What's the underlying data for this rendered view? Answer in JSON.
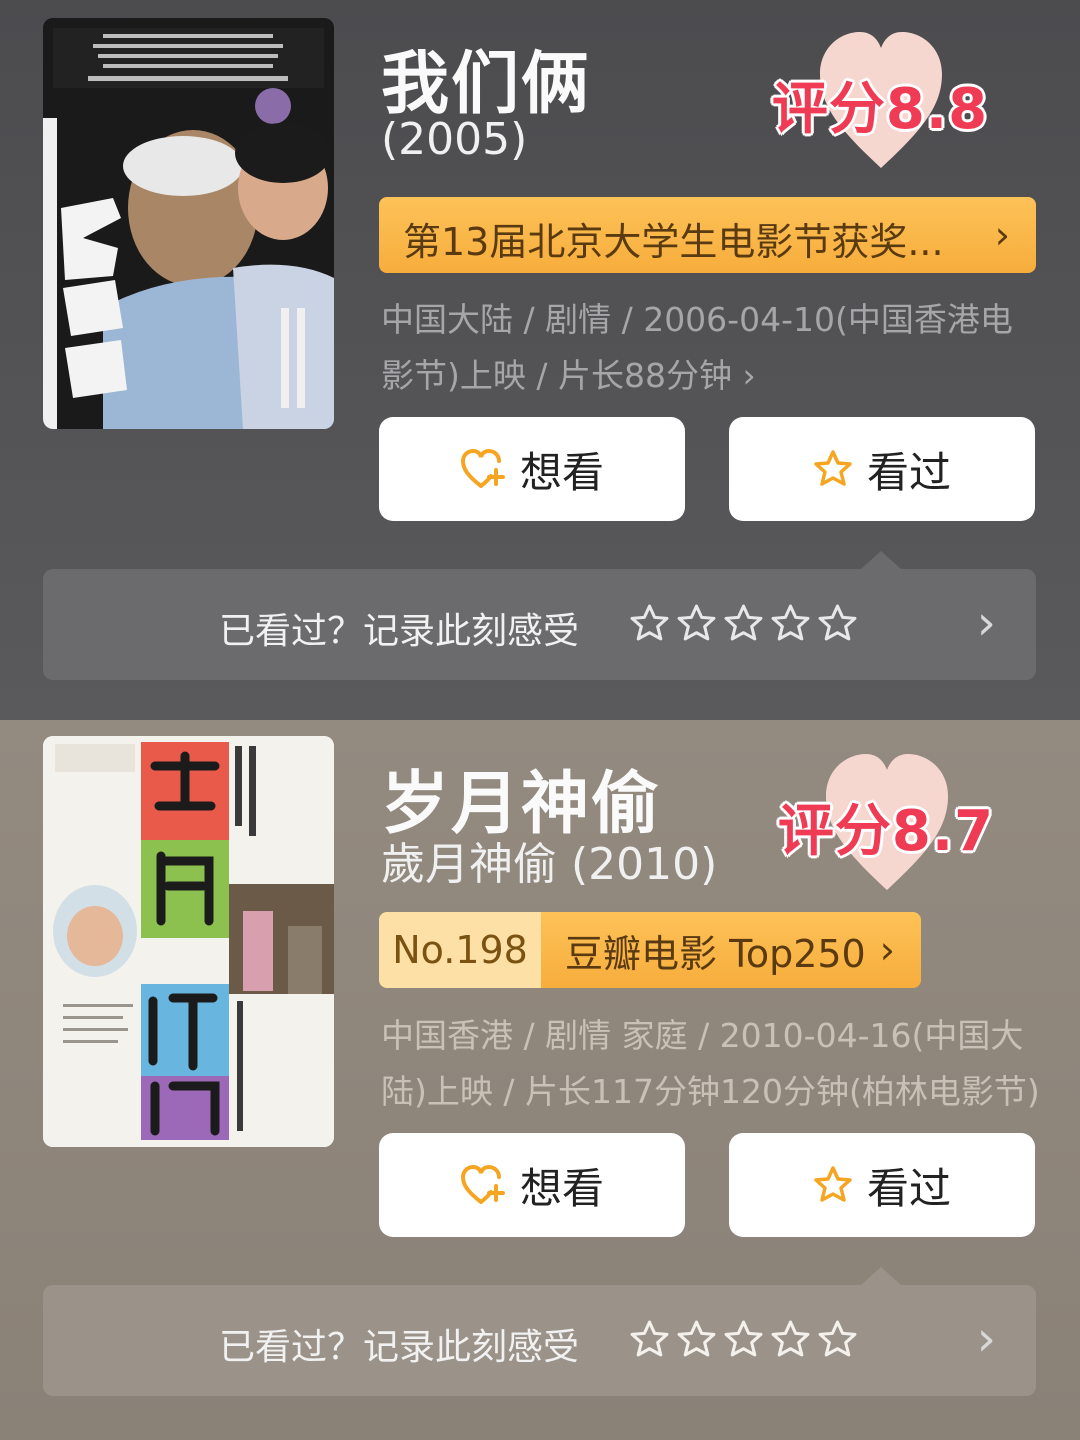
{
  "movies": [
    {
      "title": "我们俩",
      "subtitle": "(2005)",
      "rating": "评分8.8",
      "badge": "第13届北京大学生电影节获奖...",
      "meta": "中国大陆 / 剧情 / 2006-04-10(中国香港电影节)上映 / 片长88分钟 ›",
      "want_label": "想看",
      "seen_label": "看过",
      "record_text": "已看过？记录此刻感受",
      "poster_icon": "movie-poster-image"
    },
    {
      "title": "岁月神偷",
      "subtitle": "歲月神偷 (2010)",
      "rating": "评分8.7",
      "rank_no": "No.198",
      "rank_name": "豆瓣电影 Top250",
      "meta": "中国香港 / 剧情 家庭 / 2010-04-16(中国大陆)上映 / 片长117分钟120分钟(柏林电影节) ›",
      "want_label": "想看",
      "seen_label": "看过",
      "record_text": "已看过？记录此刻感受",
      "poster_icon": "movie-poster-image"
    }
  ],
  "colors": {
    "accent_orange": "#f7ad3c",
    "rating_red": "#ef3c54",
    "heart_pink": "#f6d7cf"
  }
}
